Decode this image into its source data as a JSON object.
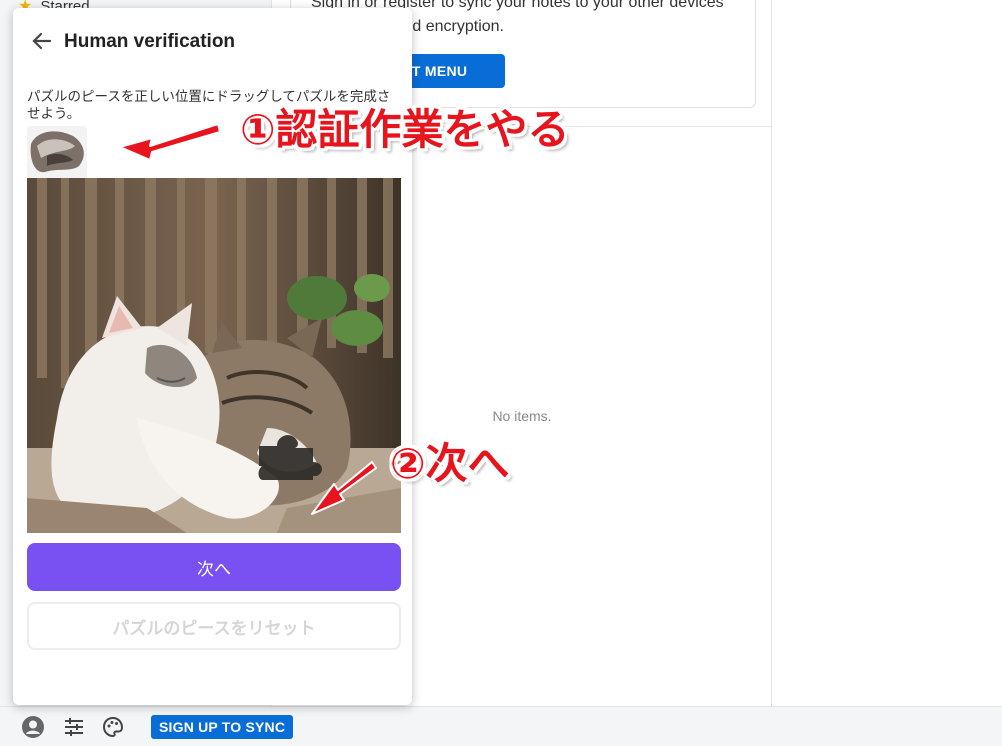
{
  "sidebar": {
    "starred_label": "Starred"
  },
  "sync_card": {
    "text": "Sign in or register to sync your notes to your other devices with end-to-end encryption.",
    "account_button": "ACCOUNT MENU"
  },
  "list": {
    "empty_text": "No items."
  },
  "footer": {
    "signup_label": "SIGN UP TO SYNC"
  },
  "modal": {
    "title": "Human verification",
    "instruction": "パズルのピースを正しい位置にドラッグしてパズルを完成させよう。",
    "next_button": "次へ",
    "reset_button": "パズルのピースをリセット"
  },
  "annotations": {
    "step1": "①認証作業をやる",
    "step2": "②次へ"
  },
  "colors": {
    "accent_blue": "#086dd6",
    "purple_button": "#7950f2",
    "annotation_red": "#e8141d"
  },
  "icons": [
    "star-icon",
    "back-arrow-icon",
    "avatar-icon",
    "sliders-icon",
    "palette-icon"
  ]
}
